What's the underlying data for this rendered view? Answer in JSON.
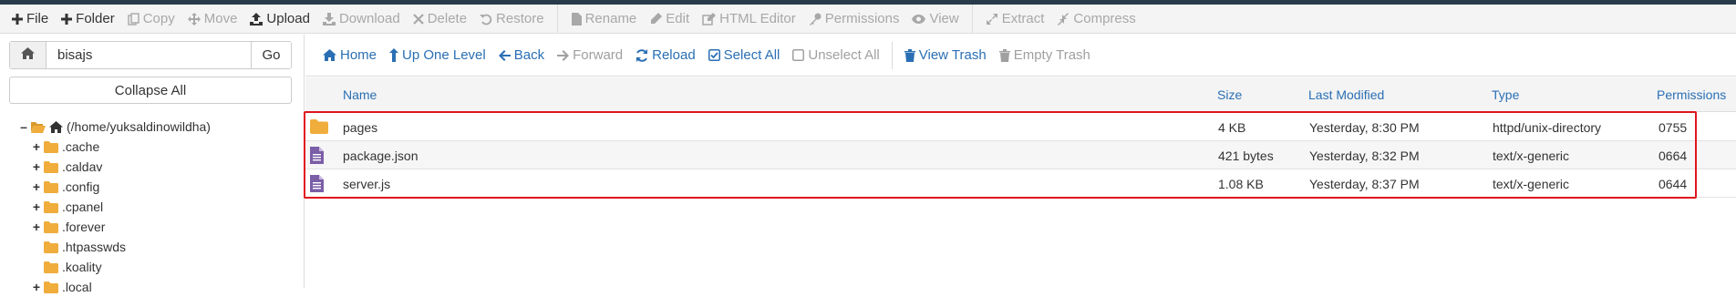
{
  "toolbar": {
    "file": "File",
    "folder": "Folder",
    "copy": "Copy",
    "move": "Move",
    "upload": "Upload",
    "download": "Download",
    "delete": "Delete",
    "restore": "Restore",
    "rename": "Rename",
    "edit": "Edit",
    "html_editor": "HTML Editor",
    "permissions": "Permissions",
    "view": "View",
    "extract": "Extract",
    "compress": "Compress"
  },
  "path_bar": {
    "value": "bisajs",
    "go_label": "Go"
  },
  "collapse_all_label": "Collapse All",
  "tree": {
    "root_label": "(/home/yuksaldinowildha)",
    "items": [
      {
        "label": ".cache",
        "expandable": true
      },
      {
        "label": ".caldav",
        "expandable": true
      },
      {
        "label": ".config",
        "expandable": true
      },
      {
        "label": ".cpanel",
        "expandable": true
      },
      {
        "label": ".forever",
        "expandable": true
      },
      {
        "label": ".htpasswds",
        "expandable": false
      },
      {
        "label": ".koality",
        "expandable": false
      },
      {
        "label": ".local",
        "expandable": true
      }
    ]
  },
  "nav": {
    "home": "Home",
    "up_one_level": "Up One Level",
    "back": "Back",
    "forward": "Forward",
    "reload": "Reload",
    "select_all": "Select All",
    "unselect_all": "Unselect All",
    "view_trash": "View Trash",
    "empty_trash": "Empty Trash"
  },
  "columns": {
    "name": "Name",
    "size": "Size",
    "modified": "Last Modified",
    "type": "Type",
    "permissions": "Permissions"
  },
  "files": [
    {
      "icon": "folder-icon",
      "name": "pages",
      "size": "4 KB",
      "modified": "Yesterday, 8:30 PM",
      "type": "httpd/unix-directory",
      "perms": "0755"
    },
    {
      "icon": "file-text-icon",
      "name": "package.json",
      "size": "421 bytes",
      "modified": "Yesterday, 8:32 PM",
      "type": "text/x-generic",
      "perms": "0664"
    },
    {
      "icon": "file-text-icon",
      "name": "server.js",
      "size": "1.08 KB",
      "modified": "Yesterday, 8:37 PM",
      "type": "text/x-generic",
      "perms": "0644"
    }
  ],
  "colors": {
    "link": "#2a6fb4",
    "folder": "#f0ad3c",
    "file": "#7b5ea7",
    "selection": "#e0141e"
  }
}
